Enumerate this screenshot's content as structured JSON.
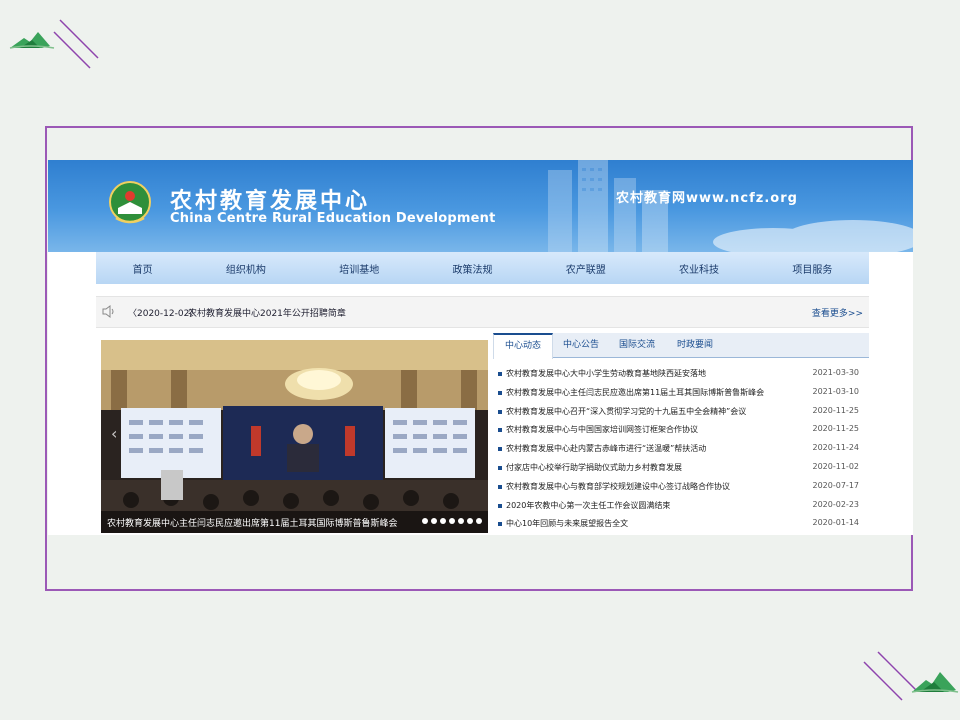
{
  "site": {
    "title_cn": "农村教育发展中心",
    "title_en": "China Centre Rural Education Development",
    "domain": "农村教育网www.ncfz.org"
  },
  "nav": {
    "items": [
      "首页",
      "组织机构",
      "培训基地",
      "政策法规",
      "农产联盟",
      "农业科技",
      "项目服务"
    ]
  },
  "notice": {
    "date": "〈2020-12-02〉",
    "title": "农村教育发展中心2021年公开招聘简章",
    "more": "查看更多>>"
  },
  "slider": {
    "caption": "农村教育发展中心主任闫志民应邀出席第11届土耳其国际博斯普鲁斯峰会",
    "dot_count": 7
  },
  "news": {
    "tabs": [
      "中心动态",
      "中心公告",
      "国际交流",
      "时政要闻"
    ],
    "active_tab": 0,
    "items": [
      {
        "title": "农村教育发展中心大中小学生劳动教育基地陕西延安落地",
        "date": "2021-03-30"
      },
      {
        "title": "农村教育发展中心主任闫志民应邀出席第11届土耳其国际博斯普鲁斯峰会",
        "date": "2021-03-10"
      },
      {
        "title": "农村教育发展中心召开“深入贯彻学习党的十九届五中全会精神”会议",
        "date": "2020-11-25"
      },
      {
        "title": "农村教育发展中心与中国国家培训网签订框架合作协议",
        "date": "2020-11-25"
      },
      {
        "title": "农村教育发展中心赴内蒙古赤峰市进行“送温暖”帮扶活动",
        "date": "2020-11-24"
      },
      {
        "title": "付家店中心校举行助学捐助仪式助力乡村教育发展",
        "date": "2020-11-02"
      },
      {
        "title": "农村教育发展中心与教育部学校规划建设中心签订战略合作协议",
        "date": "2020-07-17"
      },
      {
        "title": "2020年农教中心第一次主任工作会议圆满结束",
        "date": "2020-02-23"
      },
      {
        "title": "中心10年回顾与未来展望报告全文",
        "date": "2020-01-14"
      }
    ]
  },
  "colors": {
    "frame_border": "#9b59b6",
    "header_blue": "#2f7fd0",
    "link_blue": "#1a4d8f",
    "mountain_green": "#3aa35a"
  }
}
